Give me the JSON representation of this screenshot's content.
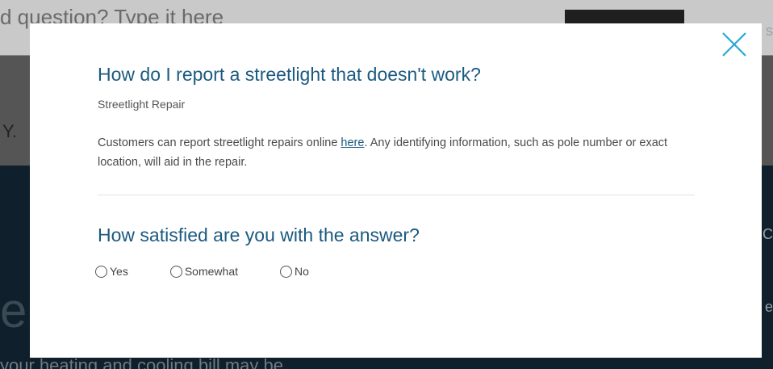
{
  "background": {
    "top_text": "d question? Type it here",
    "mid_letter": "Y.",
    "big_letter": "e",
    "bottom_text": "your heating and cooling bill may be",
    "right_fragment_top": "s",
    "right_fragment_mid": "C",
    "right_fragment_low": "e"
  },
  "modal": {
    "question": "How do I report a streetlight that doesn't work?",
    "category": "Streetlight Repair",
    "answer_before_link": "Customers can report streetlight repairs online ",
    "answer_link": "here",
    "answer_after_link": ". Any identifying information, such as pole number or exact location, will aid in the repair.",
    "satisfaction_title": "How satisfied are you with the answer?",
    "options": [
      {
        "label": "Yes"
      },
      {
        "label": "Somewhat"
      },
      {
        "label": "No"
      }
    ]
  },
  "colors": {
    "accent": "#1c5a80",
    "close_icon": "#29a8d6"
  },
  "icons": {
    "close": "close-icon",
    "radio": "radio-icon"
  }
}
